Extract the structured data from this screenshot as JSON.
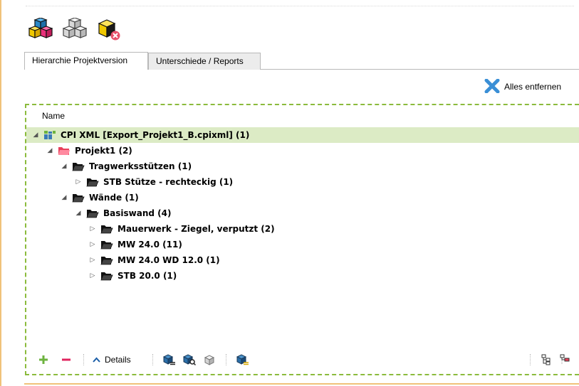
{
  "toolbar": {
    "buttons": [
      {
        "name": "colored-cubes-icon"
      },
      {
        "name": "gray-cubes-icon"
      },
      {
        "name": "cube-remove-icon"
      }
    ]
  },
  "tabs": [
    {
      "label": "Hierarchie Projektversion",
      "active": true
    },
    {
      "label": "Unterschiede / Reports",
      "active": false
    }
  ],
  "remove_all_label": "Alles entfernen",
  "tree": {
    "column_header": "Name",
    "rows": [
      {
        "label": "CPI XML [Export_Projekt1_B.cpixml] (1)",
        "level": 0,
        "expanded": true,
        "icon": "cpi-xml-icon"
      },
      {
        "label": "Projekt1 (2)",
        "level": 1,
        "expanded": true,
        "icon": "folder-red-icon"
      },
      {
        "label": "Tragwerksstützen (1)",
        "level": 2,
        "expanded": true,
        "icon": "folder-open-icon"
      },
      {
        "label": "STB Stütze - rechteckig (1)",
        "level": 3,
        "expanded": false,
        "icon": "folder-open-icon"
      },
      {
        "label": "Wände (1)",
        "level": 2,
        "expanded": true,
        "icon": "folder-open-icon"
      },
      {
        "label": "Basiswand (4)",
        "level": 3,
        "expanded": true,
        "icon": "folder-open-icon"
      },
      {
        "label": "Mauerwerk - Ziegel, verputzt (2)",
        "level": 4,
        "expanded": false,
        "icon": "folder-open-icon"
      },
      {
        "label": "MW 24.0 (11)",
        "level": 4,
        "expanded": false,
        "icon": "folder-open-icon"
      },
      {
        "label": "MW 24.0 WD 12.0 (1)",
        "level": 4,
        "expanded": false,
        "icon": "folder-open-icon"
      },
      {
        "label": "STB 20.0 (1)",
        "level": 4,
        "expanded": false,
        "icon": "folder-open-icon"
      }
    ]
  },
  "bottom_bar": {
    "details_label": "Details"
  },
  "colors": {
    "accent_green": "#8bbb3c",
    "selected_row": "#dcebc5",
    "add": "#6db33f",
    "remove": "#e0245e",
    "folder_red": "#e8405a"
  }
}
